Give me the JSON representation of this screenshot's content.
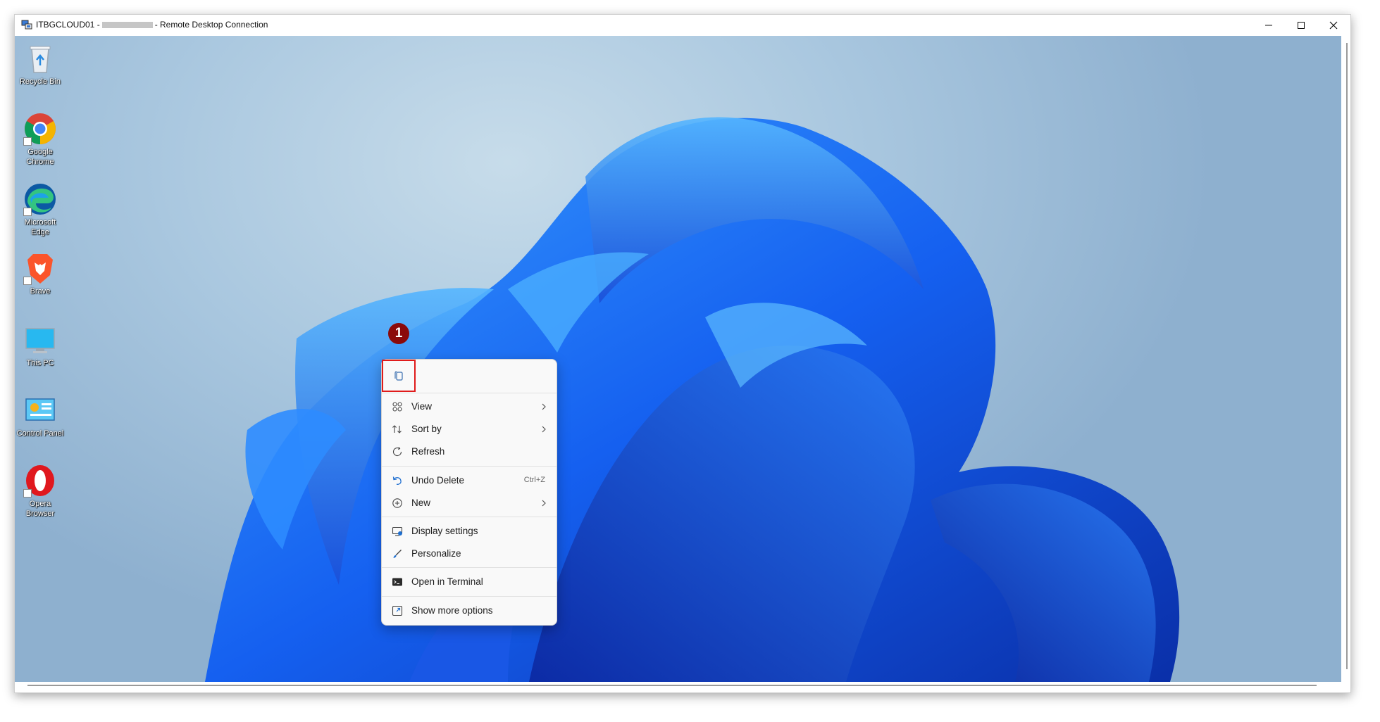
{
  "window": {
    "title_prefix": "ITBGCLOUD01 -",
    "title_suffix": "- Remote Desktop Connection"
  },
  "desktop_icons": [
    {
      "label": "Recycle Bin",
      "icon": "recycle-bin-icon"
    },
    {
      "label": "Google Chrome",
      "icon": "chrome-icon"
    },
    {
      "label": "Microsoft Edge",
      "icon": "edge-icon"
    },
    {
      "label": "Brave",
      "icon": "brave-icon"
    },
    {
      "label": "This PC",
      "icon": "this-pc-icon"
    },
    {
      "label": "Control Panel",
      "icon": "control-panel-icon"
    },
    {
      "label": "Opera Browser",
      "icon": "opera-icon"
    }
  ],
  "annotation": {
    "number": "1",
    "color": "#8b0a0a",
    "highlight_color": "#e01b1b"
  },
  "context_menu": {
    "view": "View",
    "sort_by": "Sort by",
    "refresh": "Refresh",
    "undo_delete": "Undo Delete",
    "undo_shortcut": "Ctrl+Z",
    "new": "New",
    "display_settings": "Display settings",
    "personalize": "Personalize",
    "open_terminal": "Open in Terminal",
    "show_more": "Show more options"
  },
  "colors": {
    "wallpaper_blue": "#1a66f0",
    "accent": "#0a5fd8"
  }
}
